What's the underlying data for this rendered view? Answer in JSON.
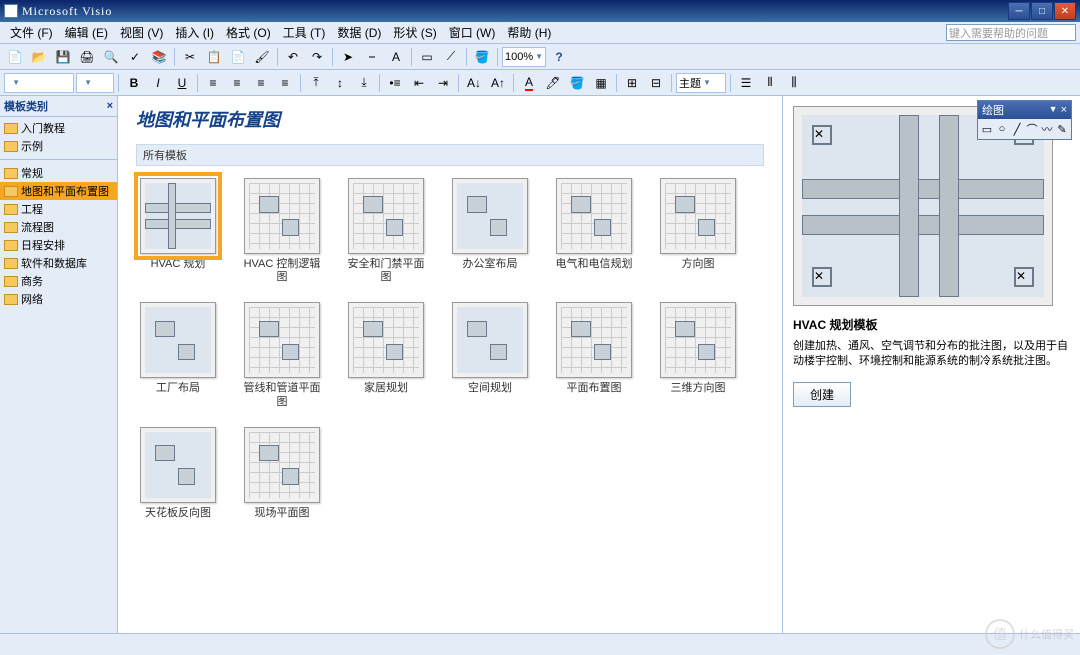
{
  "app_title": "Microsoft Visio",
  "help_placeholder": "键入需要帮助的问题",
  "menubar": [
    "文件 (F)",
    "编辑 (E)",
    "视图 (V)",
    "插入 (I)",
    "格式 (O)",
    "工具 (T)",
    "数据 (D)",
    "形状 (S)",
    "窗口 (W)",
    "帮助 (H)"
  ],
  "zoom_value": "100%",
  "sidebar": {
    "header": "模板类别",
    "top_items": [
      "入门教程",
      "示例"
    ],
    "categories": [
      "常规",
      "地图和平面布置图",
      "工程",
      "流程图",
      "日程安排",
      "软件和数据库",
      "商务",
      "网络"
    ],
    "selected_index": 1
  },
  "content": {
    "title": "地图和平面布置图",
    "section": "所有模板",
    "templates": [
      "HVAC 规划",
      "HVAC 控制逻辑图",
      "安全和门禁平面图",
      "办公室布局",
      "电气和电信规划",
      "方向图",
      "工厂布局",
      "管线和管道平面图",
      "家居规划",
      "空间规划",
      "平面布置图",
      "三维方向图",
      "天花板反向图",
      "现场平面图"
    ],
    "selected_index": 0
  },
  "preview": {
    "title": "HVAC 规划模板",
    "description": "创建加热、通风、空气调节和分布的批注图，以及用于自动楼宇控制、环境控制和能源系统的制冷系统批注图。",
    "create_button": "创建"
  },
  "float_toolbar": {
    "title": "绘图"
  },
  "watermark": "什么值得买"
}
